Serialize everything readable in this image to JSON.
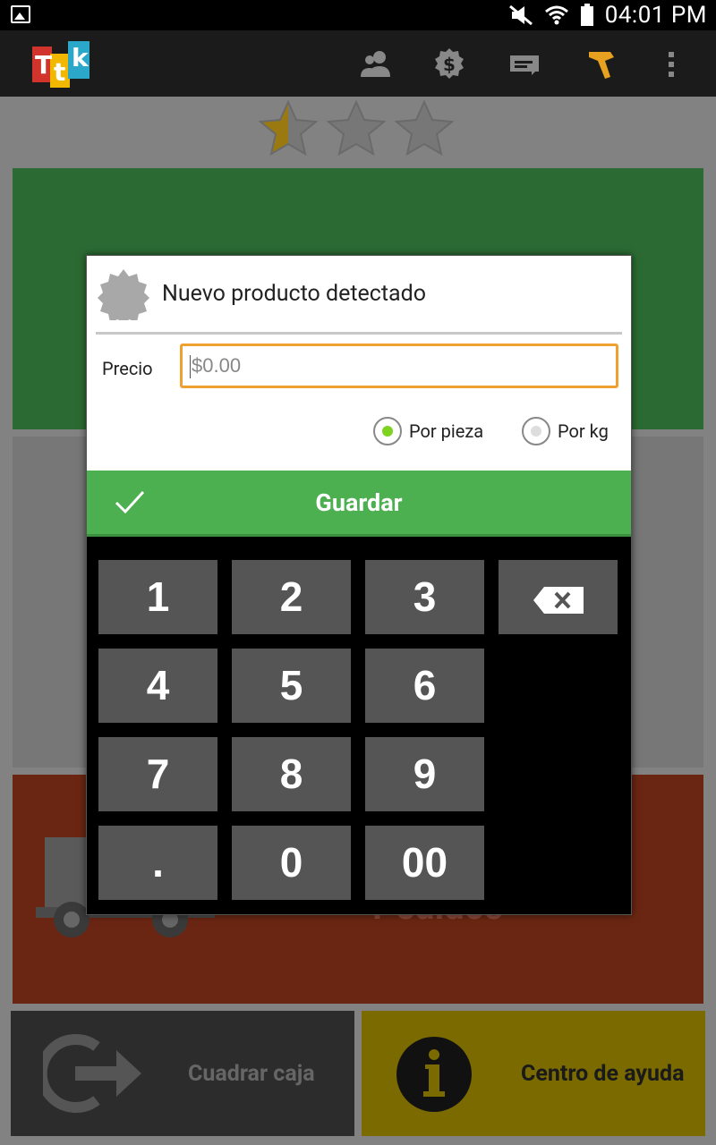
{
  "status_bar": {
    "time": "04:01 PM"
  },
  "action_bar": {
    "logo_letters": [
      "T",
      "t",
      "k"
    ],
    "icons": [
      "contacts-icon",
      "money-icon",
      "ticket-icon",
      "scanner-icon",
      "overflow-menu-icon"
    ]
  },
  "background": {
    "rating": {
      "filled": 1,
      "total": 3
    },
    "pedidos_label": "Pedidos",
    "cuadrar_caja_label": "Cuadrar caja",
    "centro_ayuda_label": "Centro de ayuda"
  },
  "dialog": {
    "title": "Nuevo producto detectado",
    "precio_label": "Precio",
    "precio_placeholder": "$0.00",
    "radio_por_pieza": "Por pieza",
    "radio_por_kg": "Por kg",
    "selected_unit": "Por pieza",
    "save_label": "Guardar"
  },
  "keypad": {
    "k1": "1",
    "k2": "2",
    "k3": "3",
    "k4": "4",
    "k5": "5",
    "k6": "6",
    "k7": "7",
    "k8": "8",
    "k9": "9",
    "kdot": ".",
    "k0": "0",
    "k00": "00"
  },
  "colors": {
    "accent_green": "#4caf50",
    "input_border": "#f0a030",
    "radio_selected": "#7ed321"
  }
}
